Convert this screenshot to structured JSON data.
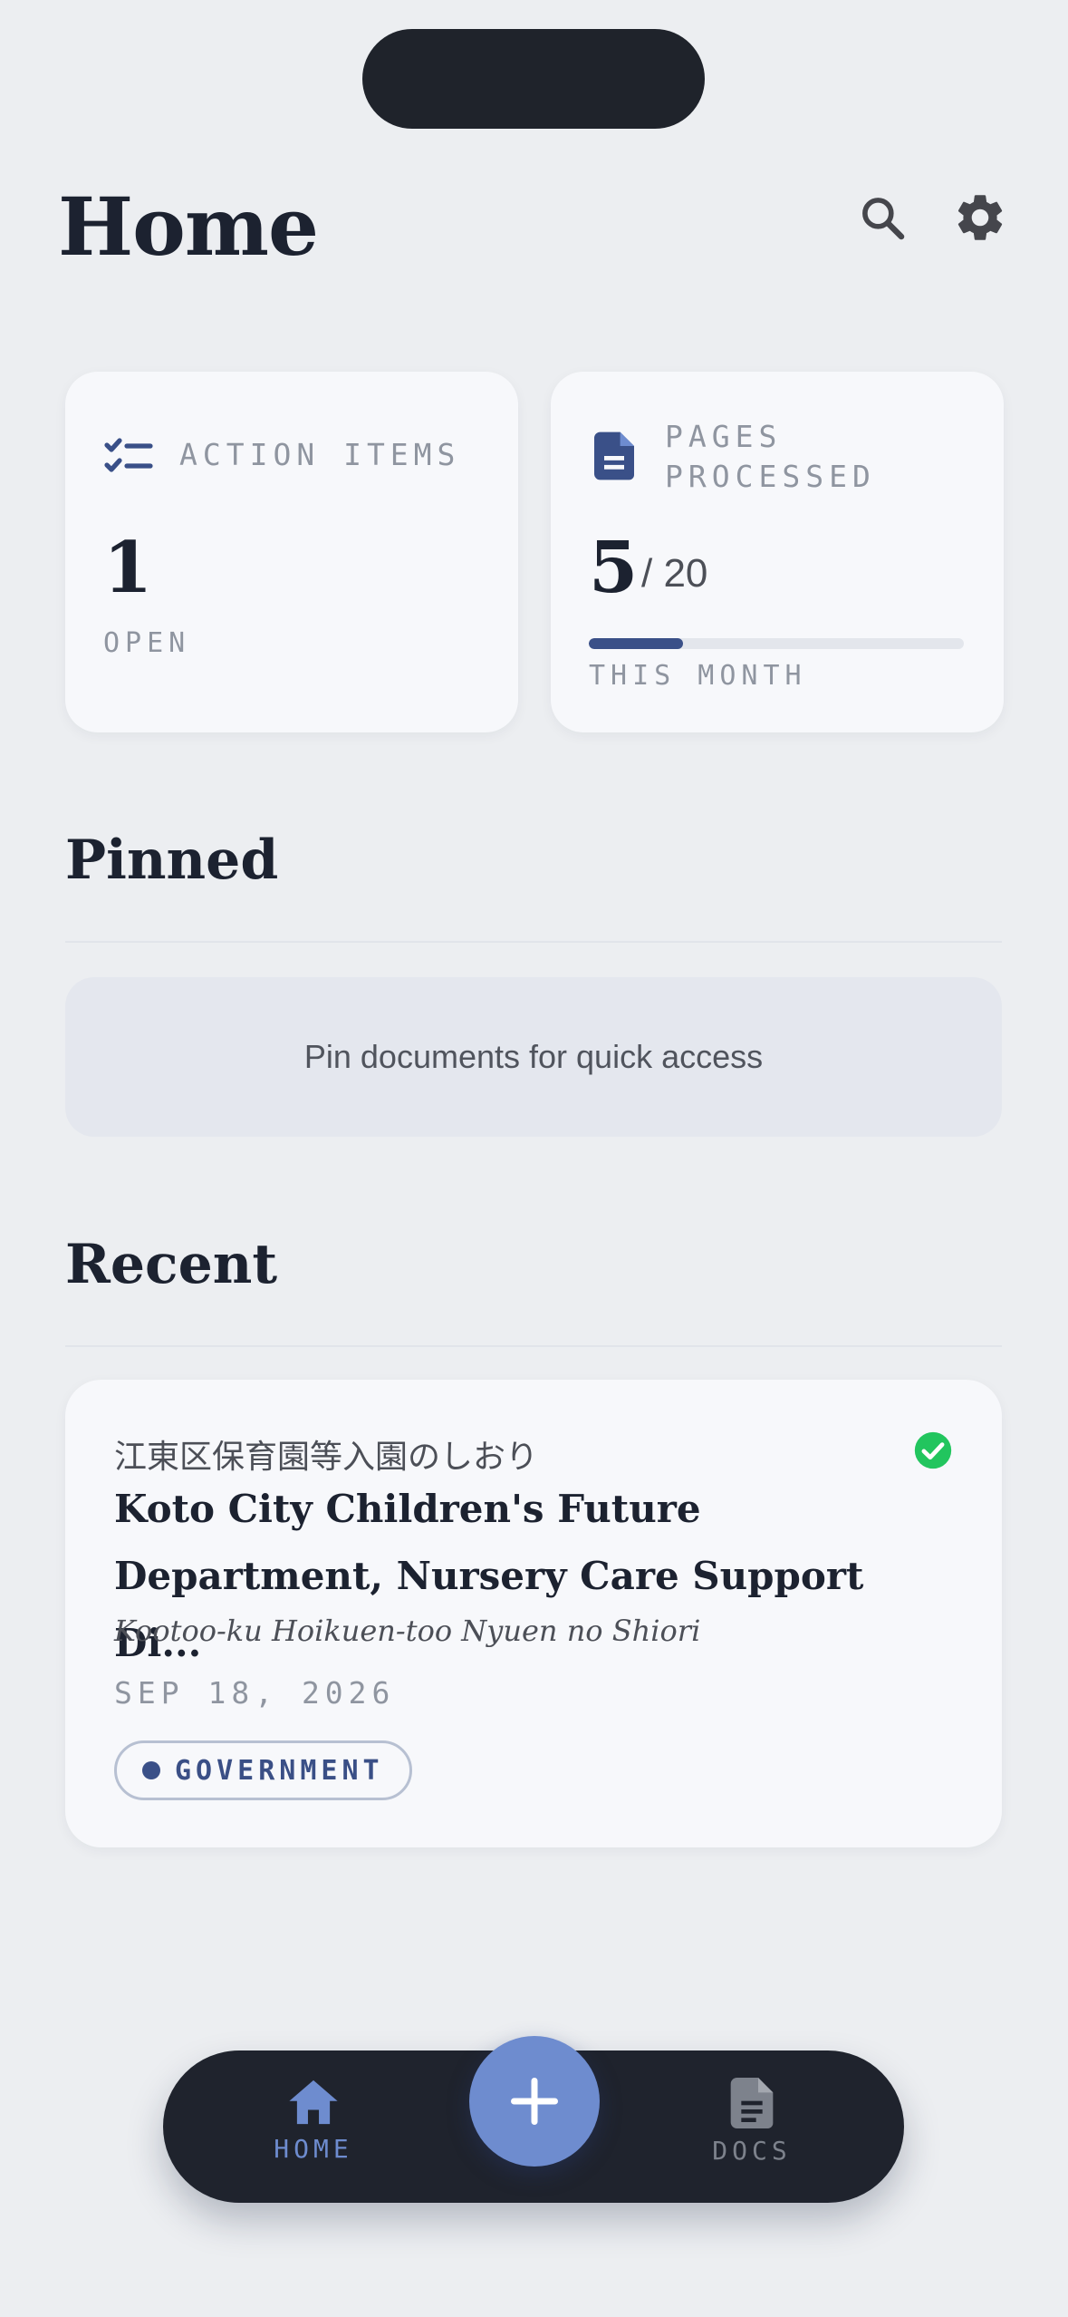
{
  "header": {
    "title": "Home"
  },
  "stats": {
    "action_items": {
      "label": "ACTION ITEMS",
      "value": "1",
      "sub": "OPEN"
    },
    "pages_processed": {
      "label_line1": "PAGES",
      "label_line2": "PROCESSED",
      "value": "5",
      "denominator": "/ 20",
      "progress_fraction": 0.25,
      "sub": "THIS MONTH"
    }
  },
  "pinned": {
    "title": "Pinned",
    "empty_text": "Pin documents for quick access"
  },
  "recent": {
    "title": "Recent",
    "items": [
      {
        "original_title": "江東区保育園等入園のしおり",
        "title": "Koto City Children's Future Department, Nursery Care Support Di...",
        "romanized": "Kootoo-ku Hoikuen-too Nyuen no Shiori",
        "date": "SEP 18, 2026",
        "tag": "GOVERNMENT",
        "status_icon": "check-circle-icon"
      }
    ]
  },
  "nav": {
    "home_label": "HOME",
    "docs_label": "DOCS",
    "fab_icon": "plus-icon"
  },
  "colors": {
    "accent": "#3a5088",
    "fab": "#6e8ccf",
    "success": "#22c55e",
    "nav_bg": "#1f232d"
  }
}
